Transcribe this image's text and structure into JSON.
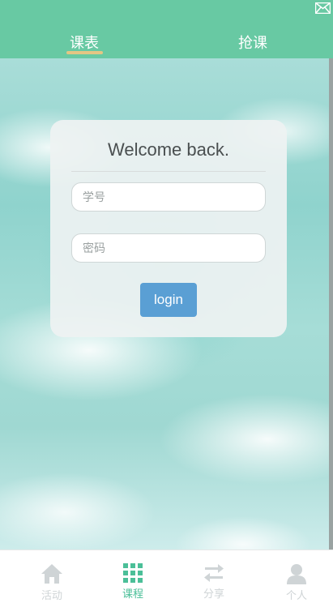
{
  "header": {
    "tabs": [
      {
        "label": "课表",
        "active": true
      },
      {
        "label": "抢课",
        "active": false
      }
    ],
    "mail_icon": "mail-icon"
  },
  "login_card": {
    "title": "Welcome back.",
    "id_placeholder": "学号",
    "password_placeholder": "密码",
    "login_label": "login"
  },
  "bottom_nav": {
    "items": [
      {
        "label": "活动",
        "icon": "home-icon",
        "active": false
      },
      {
        "label": "课程",
        "icon": "grid-icon",
        "active": true
      },
      {
        "label": "分享",
        "icon": "transfer-icon",
        "active": false
      },
      {
        "label": "个人",
        "icon": "user-icon",
        "active": false
      }
    ]
  },
  "colors": {
    "header": "#68c9a3",
    "tab_underline": "#e4c684",
    "login_button": "#5a9fd4",
    "nav_active": "#4bbf98",
    "nav_inactive": "#cfd4d6"
  }
}
